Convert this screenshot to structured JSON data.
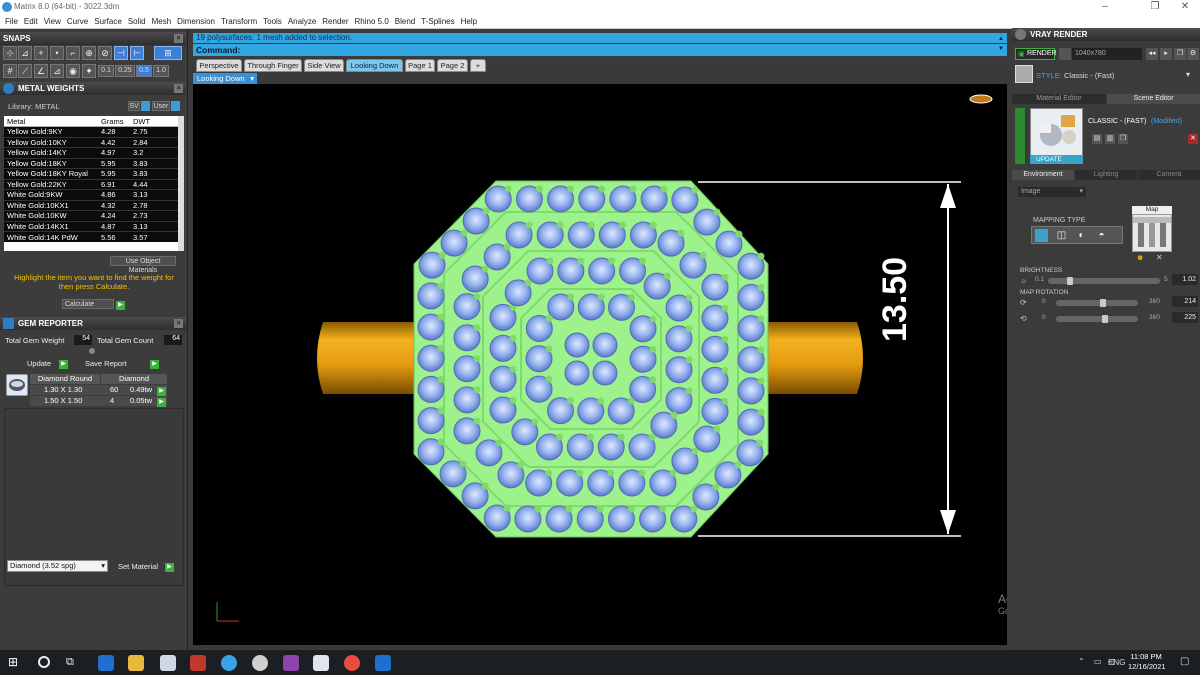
{
  "window": {
    "title": "Matrix 8.0 (64-bit) - 3022.3dm"
  },
  "menu": [
    "File",
    "Edit",
    "View",
    "Curve",
    "Surface",
    "Solid",
    "Mesh",
    "Dimension",
    "Transform",
    "Tools",
    "Analyze",
    "Render",
    "Rhino 5.0",
    "Blend",
    "T-Splines",
    "Help"
  ],
  "snaps": {
    "title": "SNAPS",
    "values": [
      "0.1",
      "0.25",
      "0.5",
      "1.0"
    ]
  },
  "metal_weights": {
    "title": "METAL WEIGHTS",
    "library_label": "Library: METAL",
    "sv_label": "SV",
    "user_label": "User",
    "columns": [
      "Metal",
      "Grams",
      "DWT"
    ],
    "rows": [
      [
        "Yellow Gold:9KY",
        "4.28",
        "2.75"
      ],
      [
        "Yellow Gold:10KY",
        "4.42",
        "2.84"
      ],
      [
        "Yellow Gold:14KY",
        "4.97",
        "3.2"
      ],
      [
        "Yellow Gold:18KY",
        "5.95",
        "3.83"
      ],
      [
        "Yellow Gold:18KY Royal",
        "5.95",
        "3.83"
      ],
      [
        "Yellow Gold:22KY",
        "6.91",
        "4.44"
      ],
      [
        "White Gold:9KW",
        "4.86",
        "3.13"
      ],
      [
        "White Gold:10KX1",
        "4.32",
        "2.78"
      ],
      [
        "White Gold:10KW",
        "4.24",
        "2.73"
      ],
      [
        "White Gold:14KX1",
        "4.87",
        "3.13"
      ],
      [
        "White Gold:14K PdW",
        "5.56",
        "3.57"
      ]
    ],
    "use_object_materials": "Use Object Materials",
    "hint": "Highlight the item you want to find the weight for then press Calculate.",
    "calculate_label": "Calculate"
  },
  "gem_reporter": {
    "title": "GEM REPORTER",
    "total_weight_label": "Total Gem Weight",
    "total_weight": "54",
    "total_count_label": "Total Gem Count",
    "total_count": "64",
    "update_label": "Update",
    "save_report_label": "Save Report",
    "columns": [
      "Diamond Round",
      "Diamond"
    ],
    "rows": [
      [
        "1.30 X 1.30",
        "60",
        "0.49tw"
      ],
      [
        "1.50 X 1.50",
        "4",
        "0.05tw"
      ]
    ],
    "material_select": "Diamond    (3.52 spg)",
    "set_material_label": "Set Material"
  },
  "command": {
    "history": "19 polysurfaces, 1 mesh added to selection.",
    "prompt": "Command:"
  },
  "view_tabs": [
    "Perspective",
    "Through Finger",
    "Side View",
    "Looking Down",
    "Page 1",
    "Page 2",
    "+"
  ],
  "active_view": "Looking Down",
  "dimension_value": "13.50",
  "watermark": {
    "line1": "Activate Windows",
    "line2": "Go to Settings to activate Windows."
  },
  "vray": {
    "title": "VRAY RENDER",
    "render_label": "RENDER",
    "resolution": "1040x780",
    "style_label": "STYLE:",
    "style_value": "Classic - (Fast)",
    "tabs": [
      "Material Editor",
      "Scene Editor"
    ],
    "preset_name": "CLASSIC - (FAST)",
    "preset_state": "(Modified)",
    "update_label": "UPDATE",
    "env_tabs": [
      "Environment",
      "Lighting",
      "Camera"
    ],
    "image_select": "Image",
    "mapping_type_label": "MAPPING TYPE",
    "map_label": "Map",
    "brightness": {
      "label": "BRIGHTNESS",
      "min": "0.1",
      "max": "5",
      "value": "1.02"
    },
    "map_rotation": {
      "label": "MAP ROTATION",
      "rows": [
        {
          "min": "0",
          "max": "360",
          "value": "214"
        },
        {
          "min": "0",
          "max": "360",
          "value": "225"
        }
      ]
    }
  },
  "taskbar": {
    "lang": "ENG",
    "time": "11:08 PM",
    "date": "12/16/2021"
  },
  "colors": {
    "accent_blue": "#31a6e0",
    "shank_gold": "#e8a21a",
    "setting_green": "#9ef28c",
    "stone_blue": "#8fb1ef"
  }
}
